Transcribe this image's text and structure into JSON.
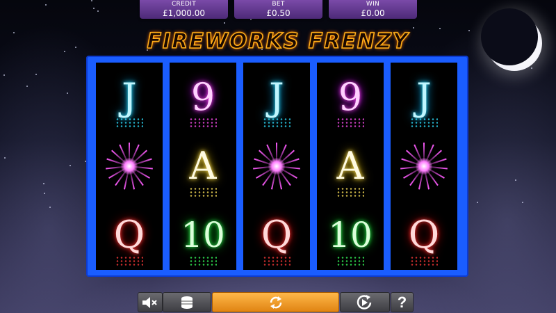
{
  "meters": {
    "credit": {
      "label": "CREDIT",
      "value": "£1,000.00"
    },
    "bet": {
      "label": "BET",
      "value": "£0.50"
    },
    "win": {
      "label": "WIN",
      "value": "£0.00"
    }
  },
  "game_title": "FIREWORKS FRENZY",
  "reels": [
    [
      "J",
      "firework",
      "Q"
    ],
    [
      "9",
      "A",
      "10"
    ],
    [
      "J",
      "firework",
      "Q"
    ],
    [
      "9",
      "A",
      "10"
    ],
    [
      "J",
      "firework",
      "Q"
    ]
  ],
  "controls": {
    "sound_icon": "speaker-muted-icon",
    "bet_icon": "coin-stack-icon",
    "spin_icon": "spin-arrows-icon",
    "autoplay_icon": "autoplay-icon",
    "help_label": "?"
  },
  "colors": {
    "frame": "#1a5dff",
    "meter": "#6a3f96",
    "spin_button": "#f5a12a",
    "title": "#ff9a1a"
  }
}
